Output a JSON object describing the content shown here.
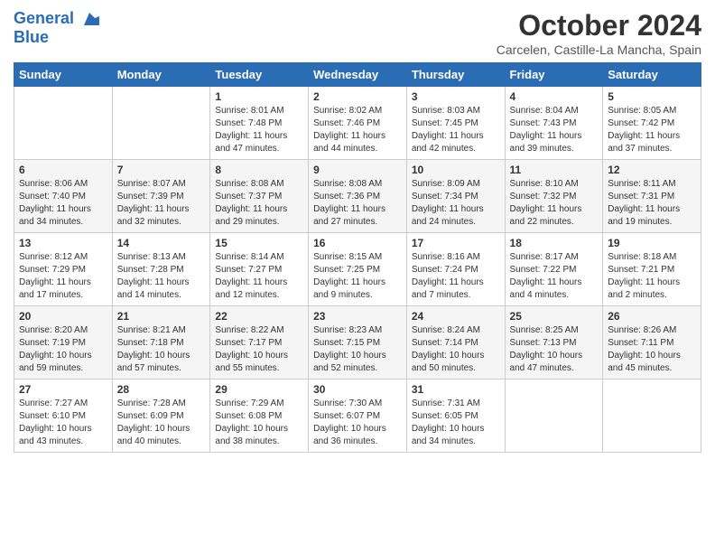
{
  "header": {
    "logo_line1": "General",
    "logo_line2": "Blue",
    "month": "October 2024",
    "location": "Carcelen, Castille-La Mancha, Spain"
  },
  "weekdays": [
    "Sunday",
    "Monday",
    "Tuesday",
    "Wednesday",
    "Thursday",
    "Friday",
    "Saturday"
  ],
  "weeks": [
    [
      {
        "day": "",
        "sunrise": "",
        "sunset": "",
        "daylight": ""
      },
      {
        "day": "",
        "sunrise": "",
        "sunset": "",
        "daylight": ""
      },
      {
        "day": "1",
        "sunrise": "Sunrise: 8:01 AM",
        "sunset": "Sunset: 7:48 PM",
        "daylight": "Daylight: 11 hours and 47 minutes."
      },
      {
        "day": "2",
        "sunrise": "Sunrise: 8:02 AM",
        "sunset": "Sunset: 7:46 PM",
        "daylight": "Daylight: 11 hours and 44 minutes."
      },
      {
        "day": "3",
        "sunrise": "Sunrise: 8:03 AM",
        "sunset": "Sunset: 7:45 PM",
        "daylight": "Daylight: 11 hours and 42 minutes."
      },
      {
        "day": "4",
        "sunrise": "Sunrise: 8:04 AM",
        "sunset": "Sunset: 7:43 PM",
        "daylight": "Daylight: 11 hours and 39 minutes."
      },
      {
        "day": "5",
        "sunrise": "Sunrise: 8:05 AM",
        "sunset": "Sunset: 7:42 PM",
        "daylight": "Daylight: 11 hours and 37 minutes."
      }
    ],
    [
      {
        "day": "6",
        "sunrise": "Sunrise: 8:06 AM",
        "sunset": "Sunset: 7:40 PM",
        "daylight": "Daylight: 11 hours and 34 minutes."
      },
      {
        "day": "7",
        "sunrise": "Sunrise: 8:07 AM",
        "sunset": "Sunset: 7:39 PM",
        "daylight": "Daylight: 11 hours and 32 minutes."
      },
      {
        "day": "8",
        "sunrise": "Sunrise: 8:08 AM",
        "sunset": "Sunset: 7:37 PM",
        "daylight": "Daylight: 11 hours and 29 minutes."
      },
      {
        "day": "9",
        "sunrise": "Sunrise: 8:08 AM",
        "sunset": "Sunset: 7:36 PM",
        "daylight": "Daylight: 11 hours and 27 minutes."
      },
      {
        "day": "10",
        "sunrise": "Sunrise: 8:09 AM",
        "sunset": "Sunset: 7:34 PM",
        "daylight": "Daylight: 11 hours and 24 minutes."
      },
      {
        "day": "11",
        "sunrise": "Sunrise: 8:10 AM",
        "sunset": "Sunset: 7:32 PM",
        "daylight": "Daylight: 11 hours and 22 minutes."
      },
      {
        "day": "12",
        "sunrise": "Sunrise: 8:11 AM",
        "sunset": "Sunset: 7:31 PM",
        "daylight": "Daylight: 11 hours and 19 minutes."
      }
    ],
    [
      {
        "day": "13",
        "sunrise": "Sunrise: 8:12 AM",
        "sunset": "Sunset: 7:29 PM",
        "daylight": "Daylight: 11 hours and 17 minutes."
      },
      {
        "day": "14",
        "sunrise": "Sunrise: 8:13 AM",
        "sunset": "Sunset: 7:28 PM",
        "daylight": "Daylight: 11 hours and 14 minutes."
      },
      {
        "day": "15",
        "sunrise": "Sunrise: 8:14 AM",
        "sunset": "Sunset: 7:27 PM",
        "daylight": "Daylight: 11 hours and 12 minutes."
      },
      {
        "day": "16",
        "sunrise": "Sunrise: 8:15 AM",
        "sunset": "Sunset: 7:25 PM",
        "daylight": "Daylight: 11 hours and 9 minutes."
      },
      {
        "day": "17",
        "sunrise": "Sunrise: 8:16 AM",
        "sunset": "Sunset: 7:24 PM",
        "daylight": "Daylight: 11 hours and 7 minutes."
      },
      {
        "day": "18",
        "sunrise": "Sunrise: 8:17 AM",
        "sunset": "Sunset: 7:22 PM",
        "daylight": "Daylight: 11 hours and 4 minutes."
      },
      {
        "day": "19",
        "sunrise": "Sunrise: 8:18 AM",
        "sunset": "Sunset: 7:21 PM",
        "daylight": "Daylight: 11 hours and 2 minutes."
      }
    ],
    [
      {
        "day": "20",
        "sunrise": "Sunrise: 8:20 AM",
        "sunset": "Sunset: 7:19 PM",
        "daylight": "Daylight: 10 hours and 59 minutes."
      },
      {
        "day": "21",
        "sunrise": "Sunrise: 8:21 AM",
        "sunset": "Sunset: 7:18 PM",
        "daylight": "Daylight: 10 hours and 57 minutes."
      },
      {
        "day": "22",
        "sunrise": "Sunrise: 8:22 AM",
        "sunset": "Sunset: 7:17 PM",
        "daylight": "Daylight: 10 hours and 55 minutes."
      },
      {
        "day": "23",
        "sunrise": "Sunrise: 8:23 AM",
        "sunset": "Sunset: 7:15 PM",
        "daylight": "Daylight: 10 hours and 52 minutes."
      },
      {
        "day": "24",
        "sunrise": "Sunrise: 8:24 AM",
        "sunset": "Sunset: 7:14 PM",
        "daylight": "Daylight: 10 hours and 50 minutes."
      },
      {
        "day": "25",
        "sunrise": "Sunrise: 8:25 AM",
        "sunset": "Sunset: 7:13 PM",
        "daylight": "Daylight: 10 hours and 47 minutes."
      },
      {
        "day": "26",
        "sunrise": "Sunrise: 8:26 AM",
        "sunset": "Sunset: 7:11 PM",
        "daylight": "Daylight: 10 hours and 45 minutes."
      }
    ],
    [
      {
        "day": "27",
        "sunrise": "Sunrise: 7:27 AM",
        "sunset": "Sunset: 6:10 PM",
        "daylight": "Daylight: 10 hours and 43 minutes."
      },
      {
        "day": "28",
        "sunrise": "Sunrise: 7:28 AM",
        "sunset": "Sunset: 6:09 PM",
        "daylight": "Daylight: 10 hours and 40 minutes."
      },
      {
        "day": "29",
        "sunrise": "Sunrise: 7:29 AM",
        "sunset": "Sunset: 6:08 PM",
        "daylight": "Daylight: 10 hours and 38 minutes."
      },
      {
        "day": "30",
        "sunrise": "Sunrise: 7:30 AM",
        "sunset": "Sunset: 6:07 PM",
        "daylight": "Daylight: 10 hours and 36 minutes."
      },
      {
        "day": "31",
        "sunrise": "Sunrise: 7:31 AM",
        "sunset": "Sunset: 6:05 PM",
        "daylight": "Daylight: 10 hours and 34 minutes."
      },
      {
        "day": "",
        "sunrise": "",
        "sunset": "",
        "daylight": ""
      },
      {
        "day": "",
        "sunrise": "",
        "sunset": "",
        "daylight": ""
      }
    ]
  ]
}
